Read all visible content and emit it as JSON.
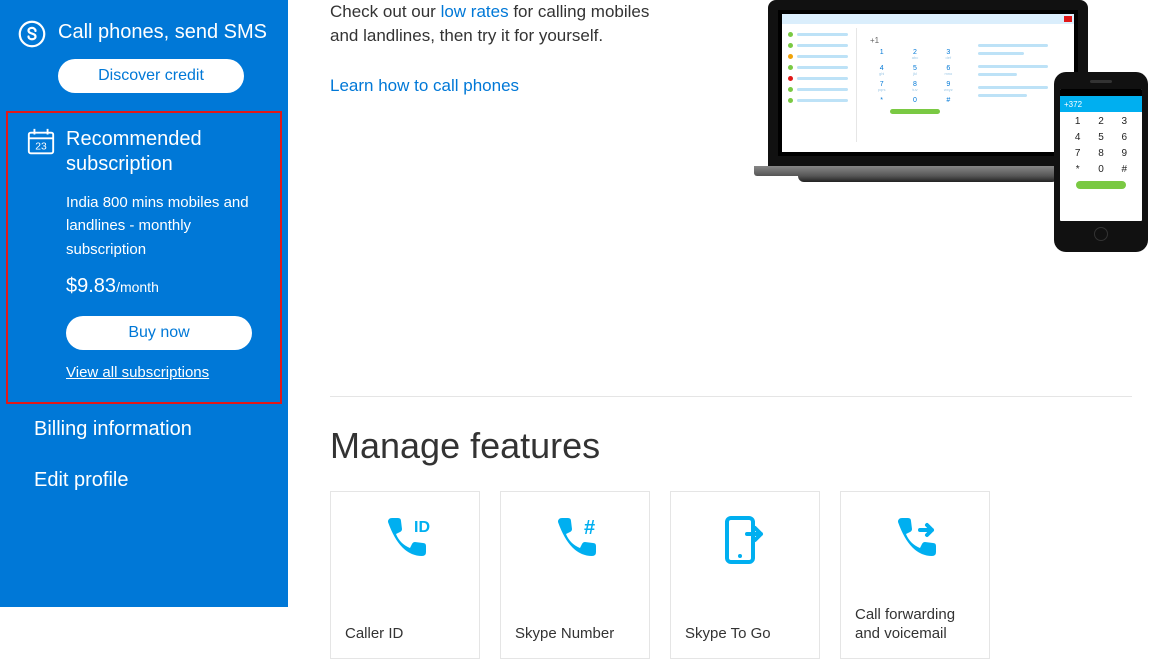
{
  "sidebar": {
    "credit": {
      "title": "Call phones, send SMS",
      "button": "Discover credit"
    },
    "recommended": {
      "title": "Recommended subscription",
      "desc": "India 800 mins mobiles and landlines - monthly subscription",
      "price_amount": "$9.83",
      "price_per": "/month",
      "buy": "Buy now",
      "view_all": "View all subscriptions"
    },
    "links": {
      "billing": "Billing information",
      "edit_profile": "Edit profile"
    }
  },
  "main": {
    "intro_pre": "Check out our ",
    "intro_link": "low rates",
    "intro_post": " for calling mobiles and landlines, then try it for yourself.",
    "learn": "Learn how to call phones",
    "phone_header": "+372",
    "manage_title": "Manage features",
    "features": [
      {
        "label": "Caller ID"
      },
      {
        "label": "Skype Number"
      },
      {
        "label": "Skype To Go"
      },
      {
        "label": "Call forwarding and voicemail"
      }
    ]
  }
}
